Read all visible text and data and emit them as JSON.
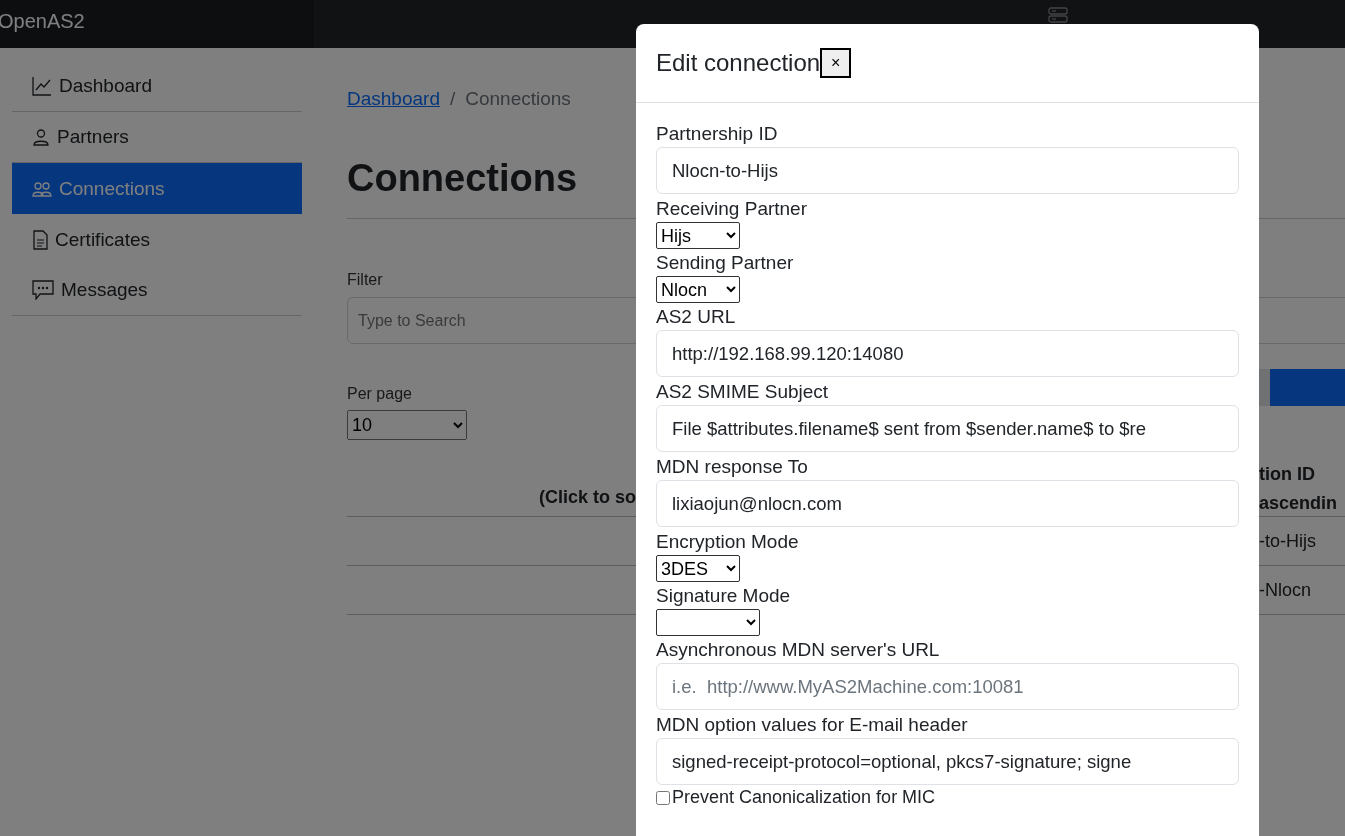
{
  "navbar": {
    "brand": "OpenAS2"
  },
  "sidebar": {
    "items": [
      {
        "label": "Dashboard",
        "selected": false
      },
      {
        "label": "Partners",
        "selected": false
      },
      {
        "label": "Connections",
        "selected": true
      },
      {
        "label": "Certificates",
        "selected": false
      },
      {
        "label": "Messages",
        "selected": false
      }
    ]
  },
  "breadcrumb": [
    {
      "label": "Dashboard",
      "kind": "link"
    },
    {
      "label": "/",
      "kind": "separator"
    },
    {
      "label": "Connections",
      "kind": "current"
    }
  ],
  "page_title": "Connections",
  "filter": {
    "label": "Filter",
    "placeholder": "Type to Search"
  },
  "per_page": {
    "label": "Per page",
    "value": "10"
  },
  "table": {
    "columns": [
      {
        "label": "(Click to so"
      },
      {
        "label": "tion ID",
        "sublabel": "ascendin"
      }
    ],
    "rows": [
      {
        "column_2": "-to-Hijs"
      },
      {
        "column_2": "-Nlocn"
      }
    ]
  },
  "modal": {
    "title": "Edit connection",
    "close": "×",
    "fields": [
      {
        "kind": "text",
        "label": "Partnership ID",
        "value": "Nlocn-to-Hijs"
      },
      {
        "kind": "select",
        "label": "Receiving Partner",
        "value": "Hijs"
      },
      {
        "kind": "select",
        "label": "Sending Partner",
        "value": "Nlocn"
      },
      {
        "kind": "text",
        "label": "AS2 URL",
        "value": "http://192.168.99.120:14080"
      },
      {
        "kind": "text",
        "label": "AS2 SMIME Subject",
        "value": "File $attributes.filename$ sent from $sender.name$ to $re"
      },
      {
        "kind": "text",
        "label": "MDN response To",
        "value": "lixiaojun@nlocn.com"
      },
      {
        "kind": "select",
        "label": "Encryption Mode",
        "value": "3DES"
      },
      {
        "kind": "select",
        "label": "Signature Mode"
      },
      {
        "kind": "text",
        "label": "Asynchronous MDN server's URL",
        "placeholder": "i.e.  http://www.MyAS2Machine.com:10081"
      },
      {
        "kind": "text",
        "label": "MDN option values for E-mail header",
        "value": "signed-receipt-protocol=optional, pkcs7-signature; signe"
      },
      {
        "kind": "checkbox",
        "label": "Prevent Canonicalization for MIC",
        "checked": false
      }
    ]
  }
}
